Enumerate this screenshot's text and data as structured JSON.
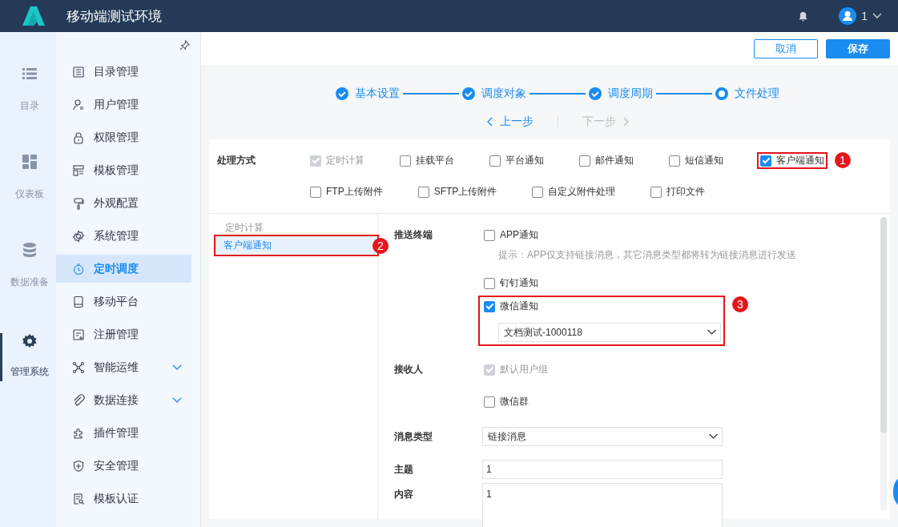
{
  "header": {
    "title": "移动端测试环境",
    "user": "1"
  },
  "rail": [
    {
      "label": "目录",
      "selected": false
    },
    {
      "label": "仪表板",
      "selected": false
    },
    {
      "label": "数据准备",
      "selected": false
    },
    {
      "label": "管理系统",
      "selected": true
    }
  ],
  "menu": [
    {
      "label": "目录管理",
      "selected": false,
      "expandable": false
    },
    {
      "label": "用户管理",
      "selected": false,
      "expandable": false
    },
    {
      "label": "权限管理",
      "selected": false,
      "expandable": false
    },
    {
      "label": "模板管理",
      "selected": false,
      "expandable": false
    },
    {
      "label": "外观配置",
      "selected": false,
      "expandable": false
    },
    {
      "label": "系统管理",
      "selected": false,
      "expandable": false
    },
    {
      "label": "定时调度",
      "selected": true,
      "expandable": false
    },
    {
      "label": "移动平台",
      "selected": false,
      "expandable": false
    },
    {
      "label": "注册管理",
      "selected": false,
      "expandable": false
    },
    {
      "label": "智能运维",
      "selected": false,
      "expandable": true
    },
    {
      "label": "数据连接",
      "selected": false,
      "expandable": true
    },
    {
      "label": "插件管理",
      "selected": false,
      "expandable": false
    },
    {
      "label": "安全管理",
      "selected": false,
      "expandable": false
    },
    {
      "label": "模板认证",
      "selected": false,
      "expandable": false
    }
  ],
  "toolbar": [
    {
      "label": "取消",
      "kind": "secondary"
    },
    {
      "label": "保存",
      "kind": "primary"
    }
  ],
  "steps": [
    {
      "label": "基本设置",
      "done": true
    },
    {
      "label": "调度对象",
      "done": true
    },
    {
      "label": "调度周期",
      "done": true
    },
    {
      "label": "文件处理",
      "done": false
    }
  ],
  "nav": {
    "prev": {
      "label": "上一步",
      "disabled": false
    },
    "next": {
      "label": "下一步",
      "disabled": true
    }
  },
  "methods": {
    "label": "处理方式",
    "options": [
      {
        "label": "定时计算",
        "checked": true,
        "disabled": true
      },
      {
        "label": "挂载平台",
        "checked": false,
        "disabled": false
      },
      {
        "label": "平台通知",
        "checked": false,
        "disabled": false
      },
      {
        "label": "邮件通知",
        "checked": false,
        "disabled": false
      },
      {
        "label": "短信通知",
        "checked": false,
        "disabled": false
      },
      {
        "label": "客户端通知",
        "checked": true,
        "disabled": false,
        "callout": "1"
      },
      {
        "label": "FTP上传附件",
        "checked": false,
        "disabled": false
      },
      {
        "label": "SFTP上传附件",
        "checked": false,
        "disabled": false
      },
      {
        "label": "自定义附件处理",
        "checked": false,
        "disabled": false
      },
      {
        "label": "打印文件",
        "checked": false,
        "disabled": false
      }
    ]
  },
  "tasks": [
    {
      "label": "定时计算",
      "selected": false
    },
    {
      "label": "客户端通知",
      "selected": true,
      "callout": "2"
    }
  ],
  "form": {
    "terminal": {
      "label": "推送终端",
      "options": [
        {
          "label": "APP通知",
          "checked": false,
          "disabled": false,
          "hint": "提示：APP仅支持链接消息，其它消息类型都将转为链接消息进行发送"
        },
        {
          "label": "钉钉通知",
          "checked": false,
          "disabled": false
        },
        {
          "label": "微信通知",
          "checked": true,
          "disabled": false,
          "callout": "3",
          "select": "文档测试-1000118"
        }
      ]
    },
    "receiver": {
      "label": "接收人",
      "options": [
        {
          "label": "默认用户组",
          "checked": true,
          "disabled": true
        },
        {
          "label": "微信群",
          "checked": false,
          "disabled": false
        }
      ]
    },
    "message_type": {
      "label": "消息类型",
      "value": "链接消息"
    },
    "subject": {
      "label": "主题",
      "value": "1"
    },
    "content": {
      "label": "内容",
      "value": "1"
    }
  }
}
